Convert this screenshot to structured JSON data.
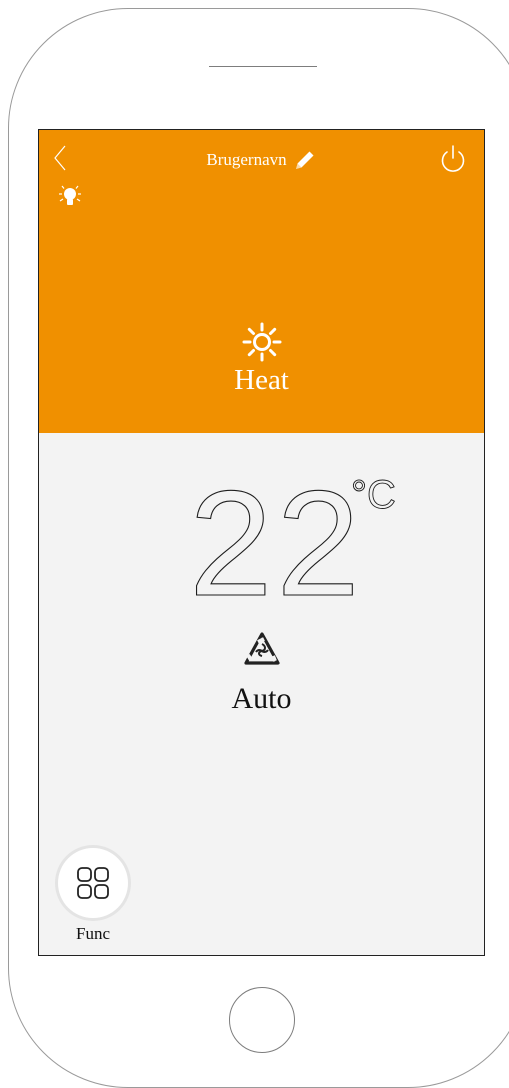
{
  "colors": {
    "accent": "#f09000",
    "screen_bg": "#f3f3f3",
    "frame": "#9a9a9a",
    "text_dark": "#111111",
    "text_light": "#ffffff"
  },
  "header": {
    "back_icon": "chevron-left-icon",
    "title": "Brugernavn",
    "edit_icon": "pencil-icon",
    "power_icon": "power-icon",
    "light_icon": "light-bulb-icon"
  },
  "mode": {
    "icon": "sun-icon",
    "label": "Heat"
  },
  "temperature": {
    "value": "22",
    "unit": "°C"
  },
  "fan": {
    "icon": "fan-icon",
    "label": "Auto"
  },
  "func": {
    "icon": "grid-icon",
    "label": "Func"
  }
}
